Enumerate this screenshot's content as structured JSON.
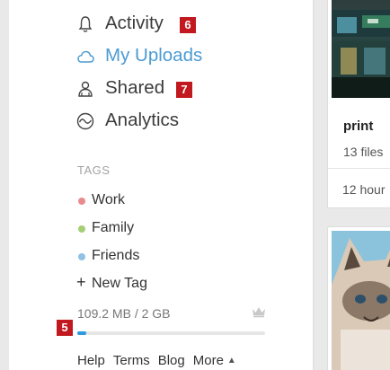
{
  "nav": {
    "items": [
      {
        "label": "Activity",
        "icon": "bell-icon",
        "active": false,
        "badge": "6"
      },
      {
        "label": "My Uploads",
        "icon": "cloud-icon",
        "active": true,
        "badge": ""
      },
      {
        "label": "Shared",
        "icon": "shared-users-icon",
        "active": false,
        "badge": "7"
      },
      {
        "label": "Analytics",
        "icon": "analytics-wave-icon",
        "active": false,
        "badge": ""
      }
    ]
  },
  "tags": {
    "heading": "TAGS",
    "items": [
      {
        "label": "Work",
        "color": "#e78b8f"
      },
      {
        "label": "Family",
        "color": "#a5cf75"
      },
      {
        "label": "Friends",
        "color": "#8fc3e4"
      }
    ],
    "new_tag_label": "New Tag"
  },
  "storage": {
    "usage_text": "109.2 MB / 2 GB",
    "used_fraction": 0.05,
    "icon": "crown-icon",
    "callout": "5"
  },
  "footer": {
    "links": [
      "Help",
      "Terms",
      "Blog",
      "More"
    ],
    "more_icon": "triangle-up-icon"
  },
  "cards": [
    {
      "title": "print",
      "subtitle": "13 files",
      "time": "12 hour"
    },
    {
      "title": "",
      "subtitle": "",
      "time": ""
    }
  ],
  "colors": {
    "accent": "#4b9bd3",
    "badge": "#c1191f",
    "progress": "#2d9ae1"
  }
}
